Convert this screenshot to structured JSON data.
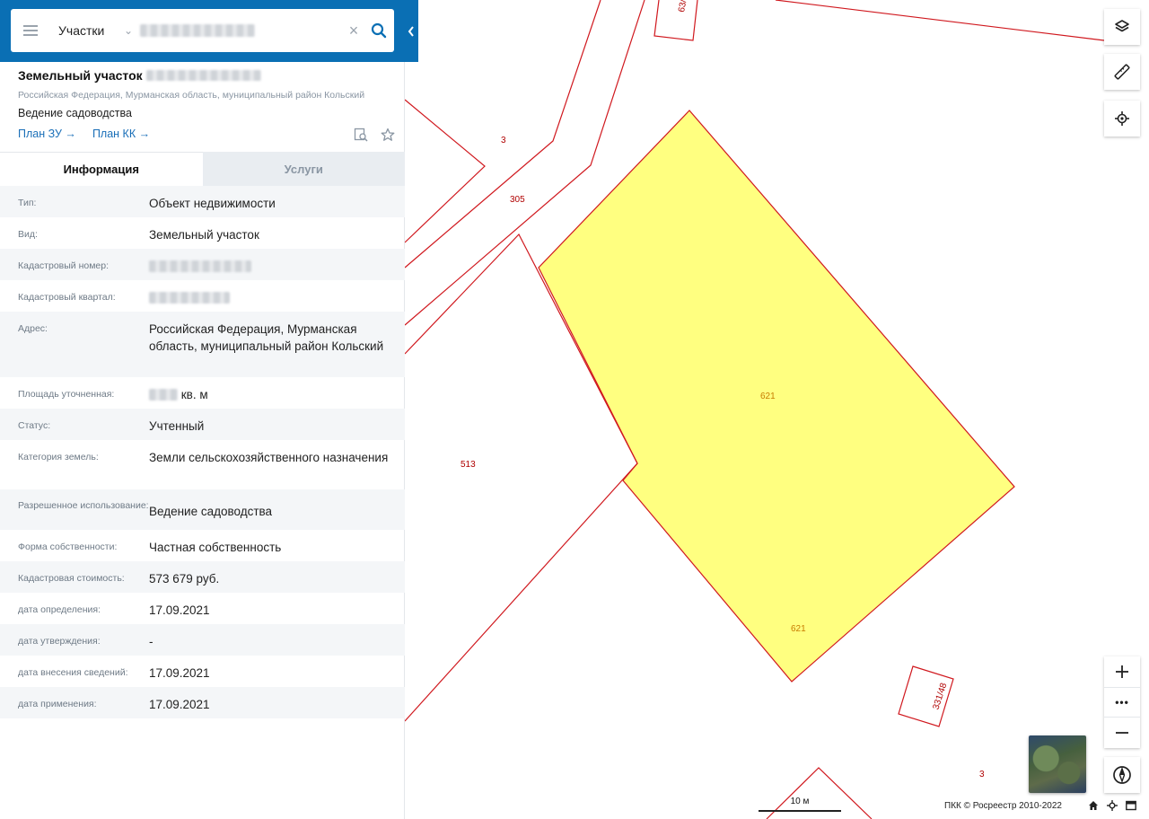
{
  "search": {
    "type_label": "Участки",
    "query_hidden": true
  },
  "parcel": {
    "title": "Земельный участок",
    "address_short": "Российская Федерация, Мурманская область, муниципальный район Кольский",
    "usage": "Ведение садоводства",
    "links": [
      "План ЗУ →",
      "План КК →"
    ]
  },
  "tabs": [
    "Информация",
    "Услуги"
  ],
  "rows": [
    {
      "key": "Тип:",
      "value": "Объект недвижимости"
    },
    {
      "key": "Вид:",
      "value": "Земельный участок"
    },
    {
      "key": "Кадастровый номер:",
      "value": ""
    },
    {
      "key": "Кадастровый квартал:",
      "value": ""
    },
    {
      "key": "Адрес:",
      "value": "Российская Федерация, Мурманская область, муниципальный район Кольский"
    },
    {
      "key": "Площадь уточненная:",
      "value": "кв. м"
    },
    {
      "key": "Статус:",
      "value": "Учтенный"
    },
    {
      "key": "Категория земель:",
      "value": "Земли сельскохозяйственного назначения"
    },
    {
      "key": "Разрешенное использование:",
      "value": "Ведение садоводства"
    },
    {
      "key": "Форма собственности:",
      "value": "Частная собственность"
    },
    {
      "key": "Кадастровая стоимость:",
      "value": "573 679 руб."
    },
    {
      "key": "дата определения:",
      "value": "17.09.2021"
    },
    {
      "key": "дата утверждения:",
      "value": "-"
    },
    {
      "key": "дата внесения сведений:",
      "value": "17.09.2021"
    },
    {
      "key": "дата применения:",
      "value": "17.09.2021"
    }
  ],
  "map": {
    "labels": {
      "l3_top": "3",
      "l305": "305",
      "l513": "513",
      "l621_a": "621",
      "l621_b": "621",
      "l3_bottom": "3",
      "l331": "331/48",
      "l63": "63/"
    },
    "highlight_color": "#ffff80",
    "boundary_color": "#d0181e"
  },
  "controls": {
    "layers_icon": "layers-icon",
    "ruler_icon": "ruler-icon",
    "locate_icon": "crosshair-icon",
    "zoom_dots": "•••"
  },
  "footer": {
    "scale": "10 м",
    "copyright": "ПКК © Росреестр 2010-2022"
  },
  "brand_color": "#0a6fb4"
}
